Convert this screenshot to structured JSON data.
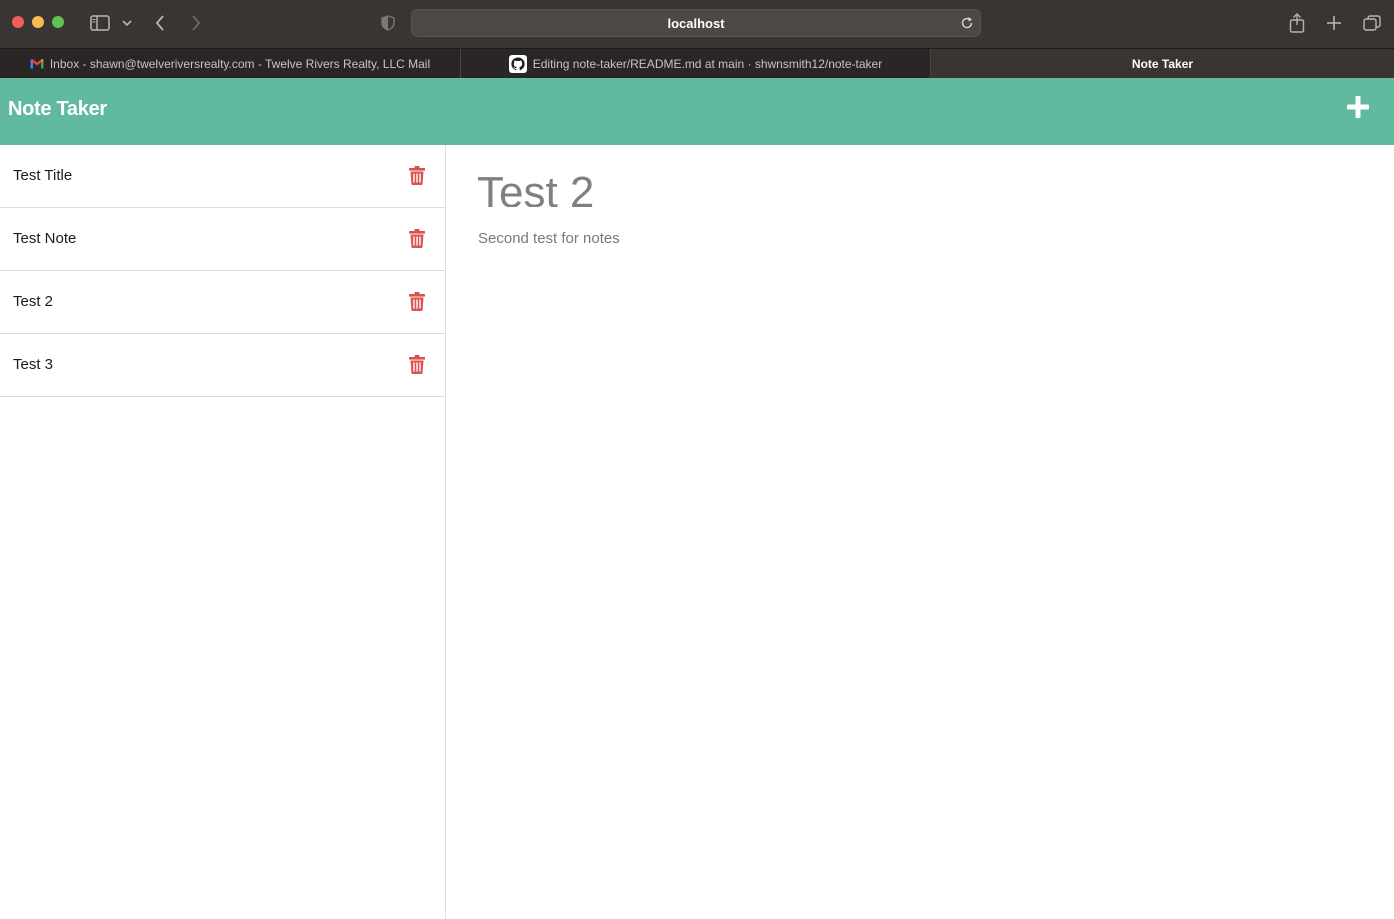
{
  "browser": {
    "url": "localhost",
    "tabs": [
      {
        "label": "Inbox - shawn@twelveriversrealty.com - Twelve Rivers Realty, LLC Mail",
        "icon": "gmail-icon",
        "active": false
      },
      {
        "label": "Editing note-taker/README.md at main · shwnsmith12/note-taker",
        "icon": "github-icon",
        "active": false
      },
      {
        "label": "Note Taker",
        "icon": "",
        "active": true
      }
    ]
  },
  "app": {
    "title": "Note Taker",
    "header_color": "#61ba9f",
    "delete_icon_color": "#d9534f",
    "add_icon": "plus-icon"
  },
  "notes": [
    {
      "title": "Test Title"
    },
    {
      "title": "Test Note"
    },
    {
      "title": "Test 2"
    },
    {
      "title": "Test 3"
    }
  ],
  "editor": {
    "title_value": "Test 2",
    "body_value": "Second test for notes"
  }
}
